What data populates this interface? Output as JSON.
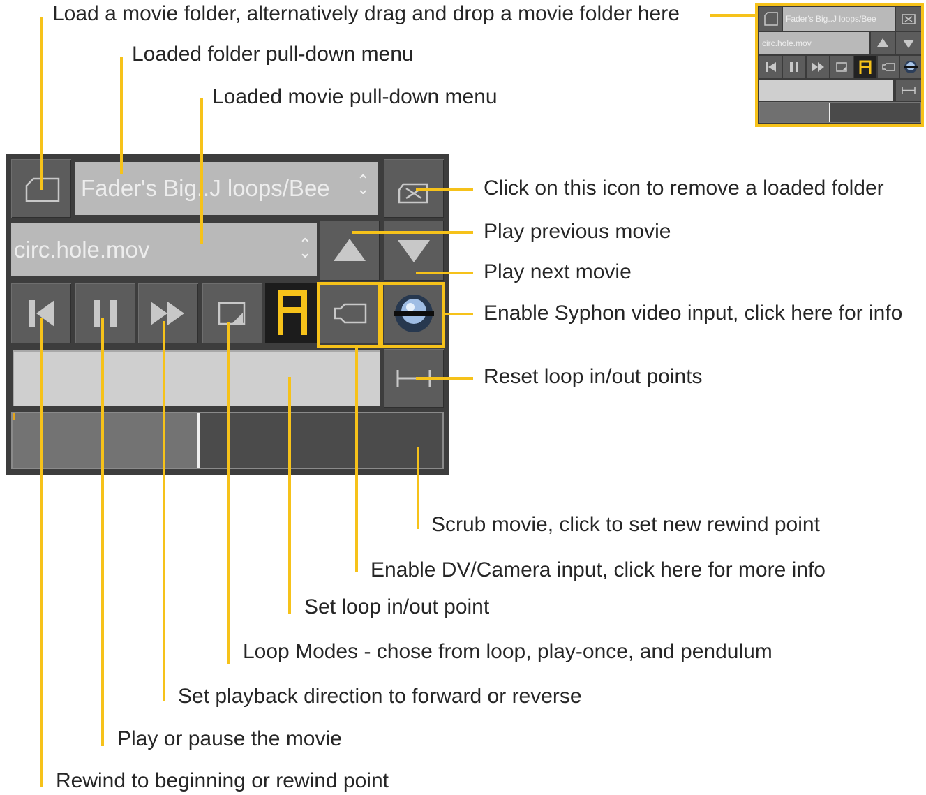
{
  "panel": {
    "folder_menu_value": "Fader's Big..J loops/Bee",
    "movie_menu_value": "circ.hole.mov",
    "scrub_progress": 0.43,
    "loop_region": [
      0.0,
      1.0
    ]
  },
  "mini": {
    "folder_menu_value": "Fader's Big..J loops/Bee",
    "movie_menu_value": "circ.hole.mov"
  },
  "annotations": {
    "load_folder": "Load a movie folder, alternatively drag and drop a movie folder here",
    "folder_menu": "Loaded folder pull-down menu",
    "movie_menu": "Loaded movie pull-down menu",
    "remove_folder": "Click on this icon to remove a loaded folder",
    "prev_movie": "Play previous movie",
    "next_movie": "Play next movie",
    "syphon": "Enable Syphon video input, click here for info",
    "reset_loop": "Reset loop in/out points",
    "scrub": "Scrub movie, click to set new rewind point",
    "dv_camera": "Enable DV/Camera input, click here for more info",
    "loop_point": "Set loop in/out point",
    "loop_modes": "Loop Modes - chose from loop, play-once, and pendulum",
    "direction": "Set playback direction to forward or reverse",
    "play_pause": "Play or pause the movie",
    "rewind": "Rewind to beginning or rewind point"
  },
  "colors": {
    "accent": "#f6c21a",
    "panel_bg": "#3d3d3d",
    "button": "#5c5c5c",
    "field": "#b9b9b9",
    "icon": "#c8c8c8"
  },
  "icons": [
    "folder-icon",
    "eject-icon",
    "triangle-up-icon",
    "triangle-down-icon",
    "skip-back-icon",
    "pause-icon",
    "fast-forward-icon",
    "loop-mode-icon",
    "loop-mode-active-icon",
    "camera-icon",
    "syphon-icon",
    "reset-loop-icon"
  ]
}
